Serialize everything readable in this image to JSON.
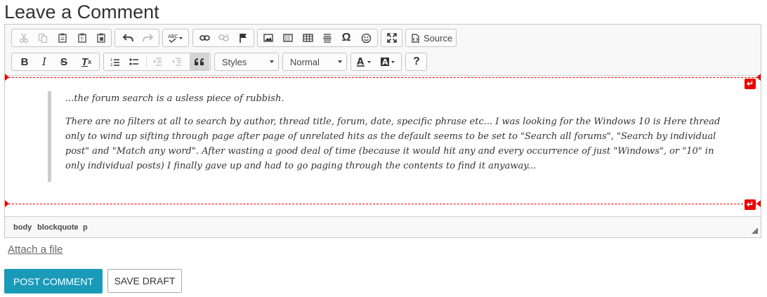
{
  "page": {
    "title": "Leave a Comment"
  },
  "toolbar": {
    "source_label": "Source",
    "styles_label": "Styles",
    "format_label": "Normal",
    "omega": "Ω",
    "help": "?"
  },
  "content": {
    "paragraphs": [
      "...the forum search is a usless piece of rubbish.",
      "There are no filters at all to search by author, thread title, forum, date, specific phrase etc... I was looking for the Windows 10 is Here thread  only to wind up sifting through page after page of unrelated hits as the default seems to be set to \"Search all forums\", \"Search by individual post\" and \"Match any word\".  After wasting a good deal of time (because it would hit any and every occurrence of just \"Windows\", or \"10\" in only individual posts) I finally gave up and had to go paging through the contents to find it anyaway..."
    ]
  },
  "statusbar": {
    "path": [
      "body",
      "blockquote",
      "p"
    ]
  },
  "attach_label": "Attach a file",
  "buttons": {
    "post": "POST COMMENT",
    "draft": "SAVE DRAFT"
  },
  "colors": {
    "accent": "#1a9ab9",
    "marker": "#e00000"
  }
}
